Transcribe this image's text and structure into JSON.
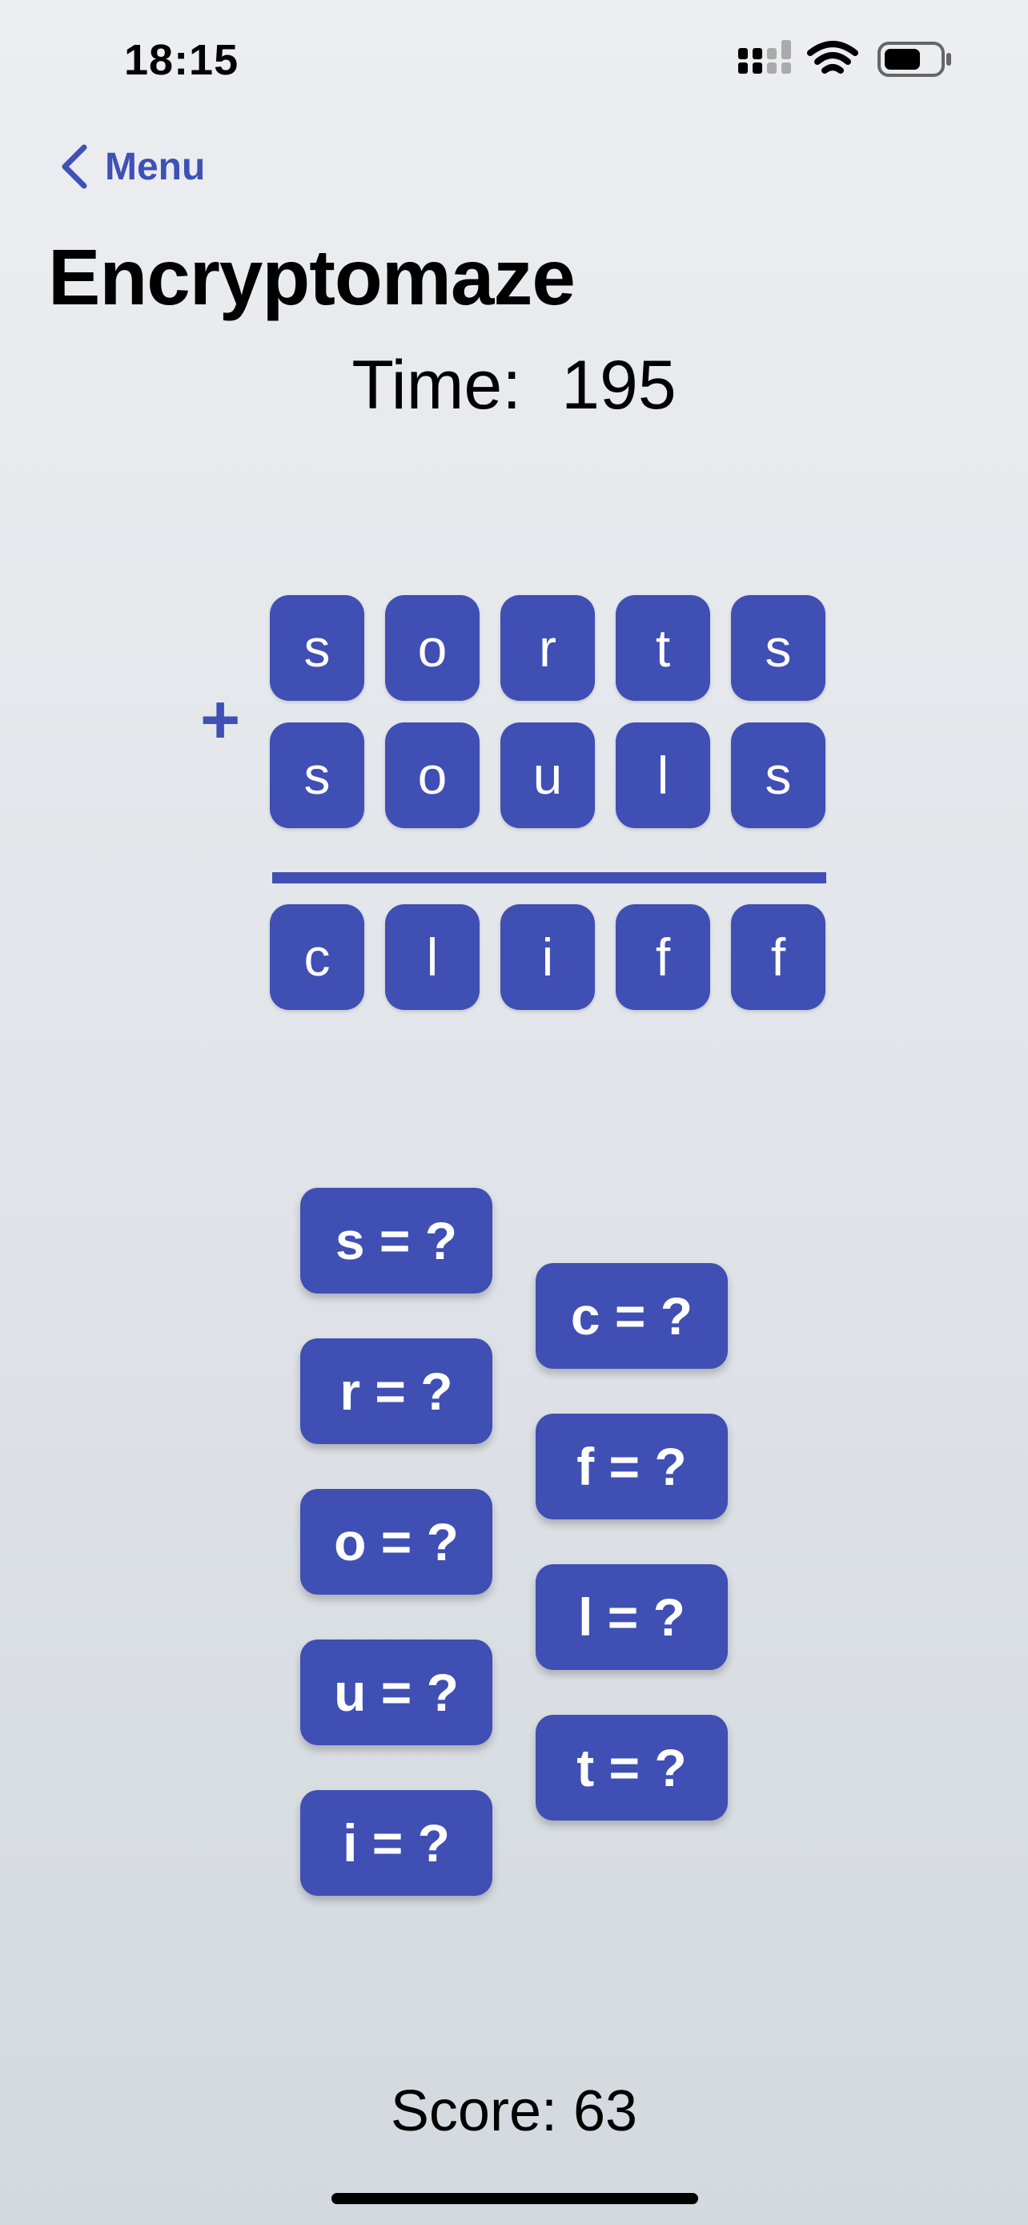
{
  "status_bar": {
    "time": "18:15"
  },
  "nav": {
    "back_label": "Menu"
  },
  "title": "Encryptomaze",
  "timer": {
    "label": "Time:",
    "value": "195"
  },
  "puzzle": {
    "operator": "+",
    "row1": [
      "s",
      "o",
      "r",
      "t",
      "s"
    ],
    "row2": [
      "s",
      "o",
      "u",
      "l",
      "s"
    ],
    "result": [
      "c",
      "l",
      "i",
      "f",
      "f"
    ]
  },
  "guesses": {
    "left": [
      "s = ?",
      "r = ?",
      "o = ?",
      "u = ?",
      "i = ?"
    ],
    "right": [
      "c = ?",
      "f = ?",
      "l = ?",
      "t = ?"
    ]
  },
  "score": "Score: 63",
  "colors": {
    "accent": "#3f4fb4",
    "link": "#3f51b5"
  }
}
